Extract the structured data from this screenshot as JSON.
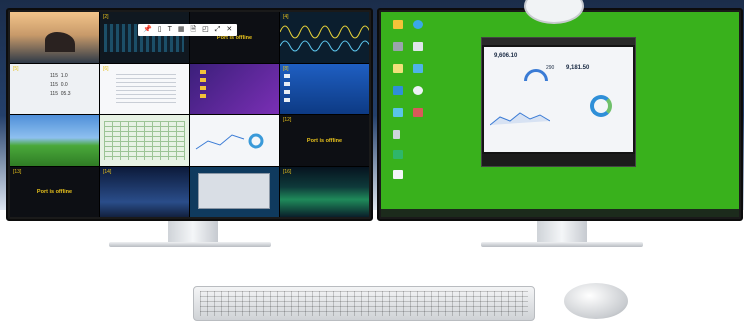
{
  "left_monitor": {
    "toolbar_icons": [
      "pin-icon",
      "monitor-icon",
      "text-icon",
      "grid-icon",
      "file-icon",
      "window-icon",
      "fullscreen-icon",
      "close-icon"
    ],
    "toolbar_glyphs": [
      "📌",
      "▯",
      "T",
      "▦",
      "🗎",
      "◰",
      "⤢",
      "✕"
    ],
    "tiles": [
      {
        "index": "",
        "offline": ""
      },
      {
        "index": "[2]",
        "offline": ""
      },
      {
        "index": "",
        "offline": "Port is offline"
      },
      {
        "index": "[4]",
        "offline": ""
      },
      {
        "index": "[5]",
        "offline": ""
      },
      {
        "index": "[6]",
        "offline": ""
      },
      {
        "index": "",
        "offline": ""
      },
      {
        "index": "[8]",
        "offline": ""
      },
      {
        "index": "",
        "offline": ""
      },
      {
        "index": "",
        "offline": ""
      },
      {
        "index": "",
        "offline": ""
      },
      {
        "index": "[12]",
        "offline": "Port is offline"
      },
      {
        "index": "[13]",
        "offline": "Port is offline"
      },
      {
        "index": "[14]",
        "offline": ""
      },
      {
        "index": "",
        "offline": ""
      },
      {
        "index": "[16]",
        "offline": ""
      }
    ],
    "meter_values": [
      "115",
      "1.0",
      "115",
      "0.0",
      "115",
      "05.3"
    ]
  },
  "right_monitor": {
    "app_values": [
      "9,606.10",
      "290",
      "9,181.50"
    ],
    "colors": {
      "desktop": "#39b11c",
      "offline_text": "#e8c21c"
    }
  }
}
